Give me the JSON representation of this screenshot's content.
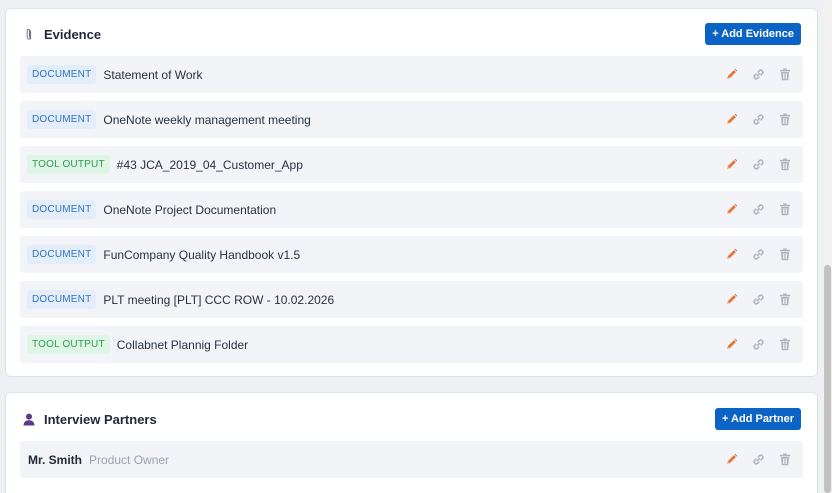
{
  "evidence": {
    "title": "Evidence",
    "icon": "paperclip-icon",
    "add_label": "+ Add Evidence",
    "items": [
      {
        "type": "DOCUMENT",
        "kind": "doc",
        "title": "Statement of Work"
      },
      {
        "type": "DOCUMENT",
        "kind": "doc",
        "title": "OneNote weekly management meeting"
      },
      {
        "type": "TOOL OUTPUT",
        "kind": "tool",
        "title": "#43 JCA_2019_04_Customer_App"
      },
      {
        "type": "DOCUMENT",
        "kind": "doc",
        "title": "OneNote Project Documentation"
      },
      {
        "type": "DOCUMENT",
        "kind": "doc",
        "title": "FunCompany Quality Handbook v1.5"
      },
      {
        "type": "DOCUMENT",
        "kind": "doc",
        "title": "PLT meeting [PLT] CCC ROW - 10.02.2026"
      },
      {
        "type": "TOOL OUTPUT",
        "kind": "tool",
        "title": "Collabnet Plannig Folder"
      }
    ]
  },
  "partners": {
    "title": "Interview Partners",
    "icon": "person-icon",
    "add_label": "+ Add Partner",
    "items": [
      {
        "name": "Mr. Smith",
        "role": "Product Owner"
      }
    ]
  },
  "colors": {
    "accent": "#0b63c5",
    "edit_icon": "#e8743b",
    "muted_icon": "#b0b5be",
    "doc_badge_bg": "#e4eefb",
    "doc_badge_text": "#2f73c4",
    "tool_badge_bg": "#dff5e6",
    "tool_badge_text": "#2f9a55"
  }
}
